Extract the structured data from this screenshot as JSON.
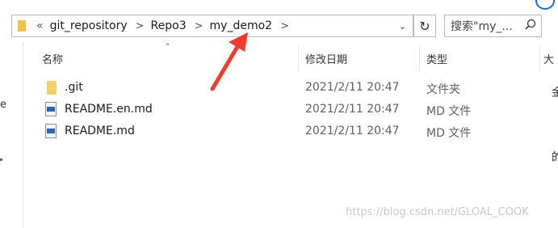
{
  "address_bar": {
    "crumbs": [
      "«",
      "git_repository",
      "Repo3",
      "my_demo2"
    ],
    "separator": ">"
  },
  "search": {
    "placeholder": "搜索\"my_...",
    "icon": "search-icon"
  },
  "columns": {
    "name": "名称",
    "modified": "修改日期",
    "type": "类型",
    "size_fragment": "大"
  },
  "files": [
    {
      "name": ".git",
      "modified": "2021/2/11 20:47",
      "type": "文件夹",
      "icon": "folder-icon"
    },
    {
      "name": "README.en.md",
      "modified": "2021/2/11 20:47",
      "type": "MD 文件",
      "icon": "md-file-icon"
    },
    {
      "name": "README.md",
      "modified": "2021/2/11 20:47",
      "type": "MD 文件",
      "icon": "md-file-icon"
    }
  ],
  "left_fragments": [
    "e"
  ],
  "right_fragments": [
    "金",
    "的"
  ],
  "watermark": "https://blog.csdn.net/GLOAL_COOK"
}
